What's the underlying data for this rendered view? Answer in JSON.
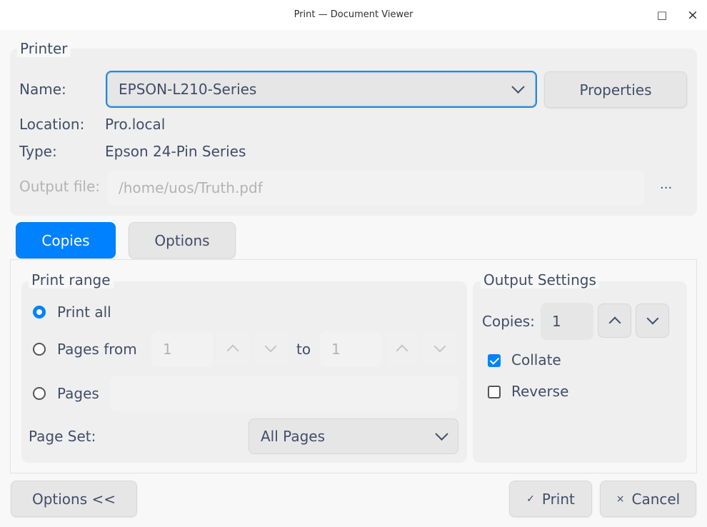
{
  "window": {
    "title": "Print — Document Viewer",
    "maximize_icon": "□",
    "close_icon": "×"
  },
  "printer": {
    "group_title": "Printer",
    "name_label": "Name:",
    "name_value": "EPSON-L210-Series",
    "properties_label": "Properties",
    "location_label": "Location:",
    "location_value": "Pro.local",
    "type_label": "Type:",
    "type_value": "Epson 24-Pin Series",
    "output_file_label": "Output file:",
    "output_file_value": "/home/uos/Truth.pdf",
    "browse_label": "..."
  },
  "tabs": [
    {
      "label": "Copies",
      "active": true
    },
    {
      "label": "Options",
      "active": false
    }
  ],
  "print_range": {
    "group_title": "Print range",
    "print_all_label": "Print all",
    "pages_from_label": "Pages from",
    "from_value": "1",
    "to_label": "to",
    "to_value": "1",
    "pages_label": "Pages",
    "page_set_label": "Page Set:",
    "page_set_value": "All Pages"
  },
  "output_settings": {
    "group_title": "Output Settings",
    "copies_label": "Copies:",
    "copies_value": "1",
    "collate_label": "Collate",
    "collate_checked": true,
    "reverse_label": "Reverse",
    "reverse_checked": false
  },
  "footer": {
    "options_toggle_label": "Options <<",
    "print_icon": "✓",
    "print_label": "Print",
    "cancel_icon": "×",
    "cancel_label": "Cancel"
  },
  "colors": {
    "accent": "#0081ff",
    "focus_border": "#2a86d6",
    "text": "#414d68"
  }
}
